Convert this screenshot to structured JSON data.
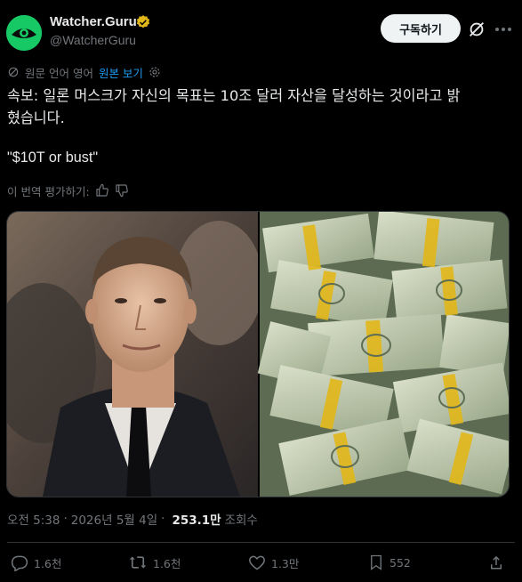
{
  "author": {
    "display_name": "Watcher.Guru",
    "handle": "@WatcherGuru",
    "avatar_icon": "eye-logo-icon",
    "brand_color": "#17c964",
    "verified_color": "#e2b719"
  },
  "header": {
    "subscribe_label": "구독하기",
    "grok_icon": "grok-icon",
    "more_icon": "more-horizontal-icon"
  },
  "translation": {
    "source_label": "원문 언어 영어",
    "show_original_label": "원본 보기",
    "rate_label": "이 번역 평가하기:"
  },
  "tweet": {
    "line1": "속보: 일론 머스크가 자신의 목표는 10조 달러 자산을 달성하는 것이라고 밝",
    "line2": "혔습니다.",
    "quote": "\"$10T or bust\""
  },
  "meta": {
    "time": "오전 5:38",
    "separator": "·",
    "date": "2026년 5월 4일",
    "views_count": "253.1만",
    "views_label": "조회수"
  },
  "actions": {
    "replies": "1.6천",
    "reposts": "1.6천",
    "likes": "1.3만",
    "bookmarks": "552"
  },
  "colors": {
    "accent": "#1d9bf0",
    "muted": "#71767b",
    "text": "#e7e9ea"
  }
}
